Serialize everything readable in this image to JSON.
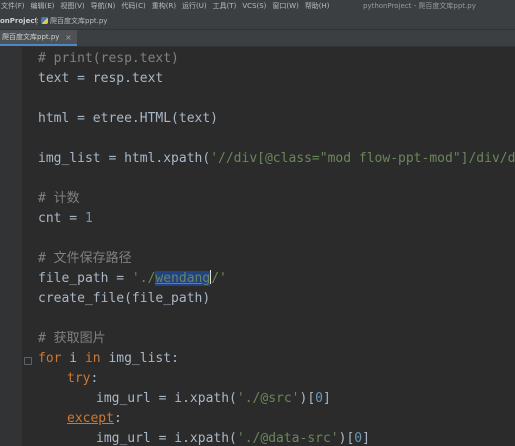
{
  "menubar": {
    "items": [
      "文件(F)",
      "编辑(E)",
      "视图(V)",
      "导航(N)",
      "代码(C)",
      "重构(R)",
      "运行(U)",
      "工具(T)",
      "VCS(S)",
      "窗口(W)",
      "帮助(H)"
    ],
    "window_title": "pythonProject - 爬百度文库ppt.py"
  },
  "navbar": {
    "project": "onProject",
    "file": "爬百度文库ppt.py"
  },
  "tab": {
    "label": "爬百度文库ppt.py",
    "close": "×"
  },
  "code": {
    "l1": "# print(resp.text)",
    "l2a": "text = resp.text",
    "l3a": "html = etree.HTML(text)",
    "l4a": "img_list = html.xpath(",
    "l4b": "'//div[@class=\"mod flow-ppt-mod\"]/div/div/im",
    "l5": "# 计数",
    "l6a": "cnt = ",
    "l6b": "1",
    "l7": "# 文件保存路径",
    "l8a": "file_path = ",
    "l8b": "'./",
    "l8c": "wendang",
    "l8d": "/'",
    "l9": "create_file(file_path)",
    "l10": "# 获取图片",
    "l11a": "for",
    "l11b": " i ",
    "l11c": "in",
    "l11d": " img_list:",
    "l12": "try",
    "l12b": ":",
    "l13a": "img_url = i.xpath(",
    "l13b": "'./@src'",
    "l13c": ")[",
    "l13d": "0",
    "l13e": "]",
    "l14": "except",
    "l14b": ":",
    "l15a": "img_url = i.xpath(",
    "l15b": "'./@data-src'",
    "l15c": ")[",
    "l15d": "0",
    "l15e": "]"
  }
}
